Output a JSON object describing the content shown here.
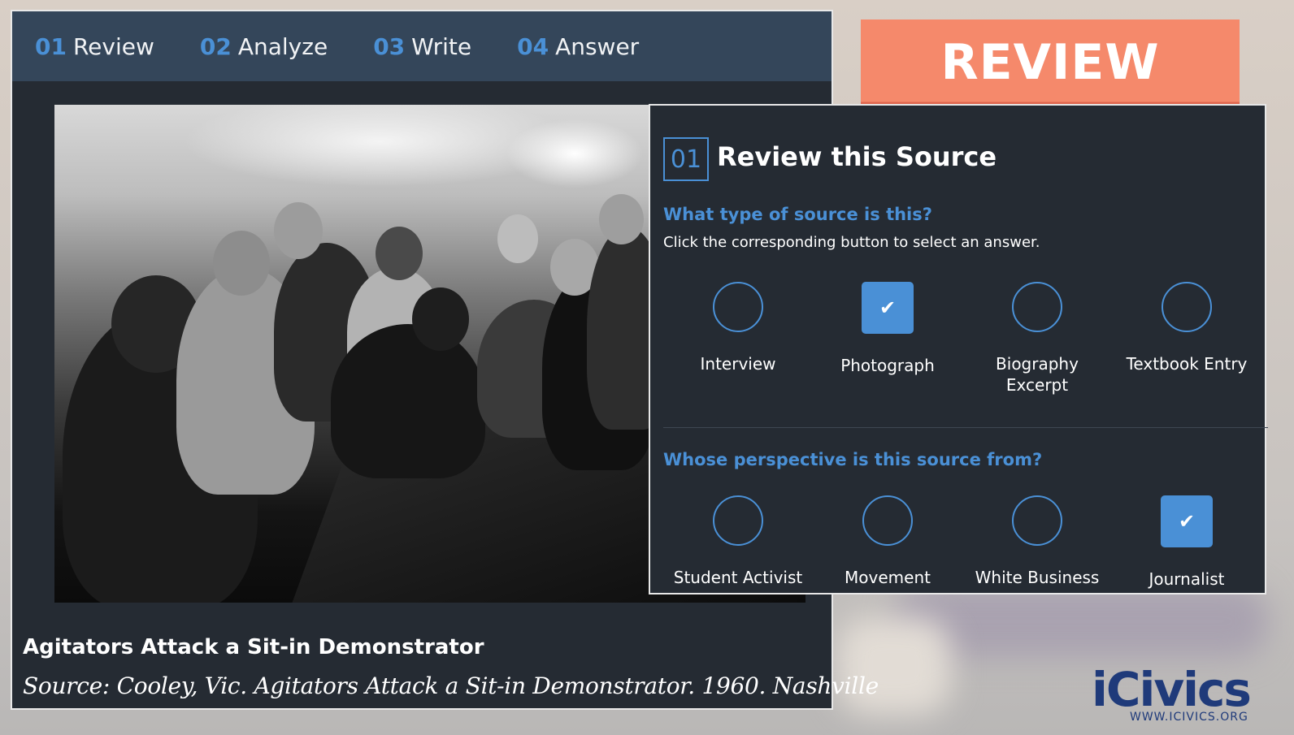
{
  "tabs": [
    {
      "num": "01",
      "label": "Review"
    },
    {
      "num": "02",
      "label": "Analyze"
    },
    {
      "num": "03",
      "label": "Write"
    },
    {
      "num": "04",
      "label": "Answer"
    }
  ],
  "banner": "REVIEW",
  "caption": {
    "title": "Agitators Attack a Sit-in Demonstrator",
    "source": "Source: Cooley, Vic. Agitators Attack a Sit-in Demonstrator. 1960. Nashville"
  },
  "review": {
    "step": "01",
    "title": "Review this Source",
    "q1": {
      "question": "What type of source is this?",
      "instruction": "Click the corresponding button to select an answer.",
      "options": [
        {
          "label": "Interview",
          "selected": false
        },
        {
          "label": "Photograph",
          "selected": true
        },
        {
          "label": "Biography Excerpt",
          "selected": false
        },
        {
          "label": "Textbook Entry",
          "selected": false
        }
      ]
    },
    "q2": {
      "question": "Whose perspective is this source from?",
      "options": [
        {
          "label": "Student Activist",
          "selected": false
        },
        {
          "label": "Movement",
          "selected": false
        },
        {
          "label": "White Business",
          "selected": false
        },
        {
          "label": "Journalist",
          "selected": true
        }
      ]
    }
  },
  "icons": {
    "checkmark": "✔"
  },
  "colors": {
    "accent": "#4a90d6",
    "panel": "#252b33",
    "tabbar": "#34465a",
    "banner": "#f5896b"
  },
  "logo": {
    "word": "iCivics",
    "url": "WWW.ICIVICS.ORG"
  }
}
